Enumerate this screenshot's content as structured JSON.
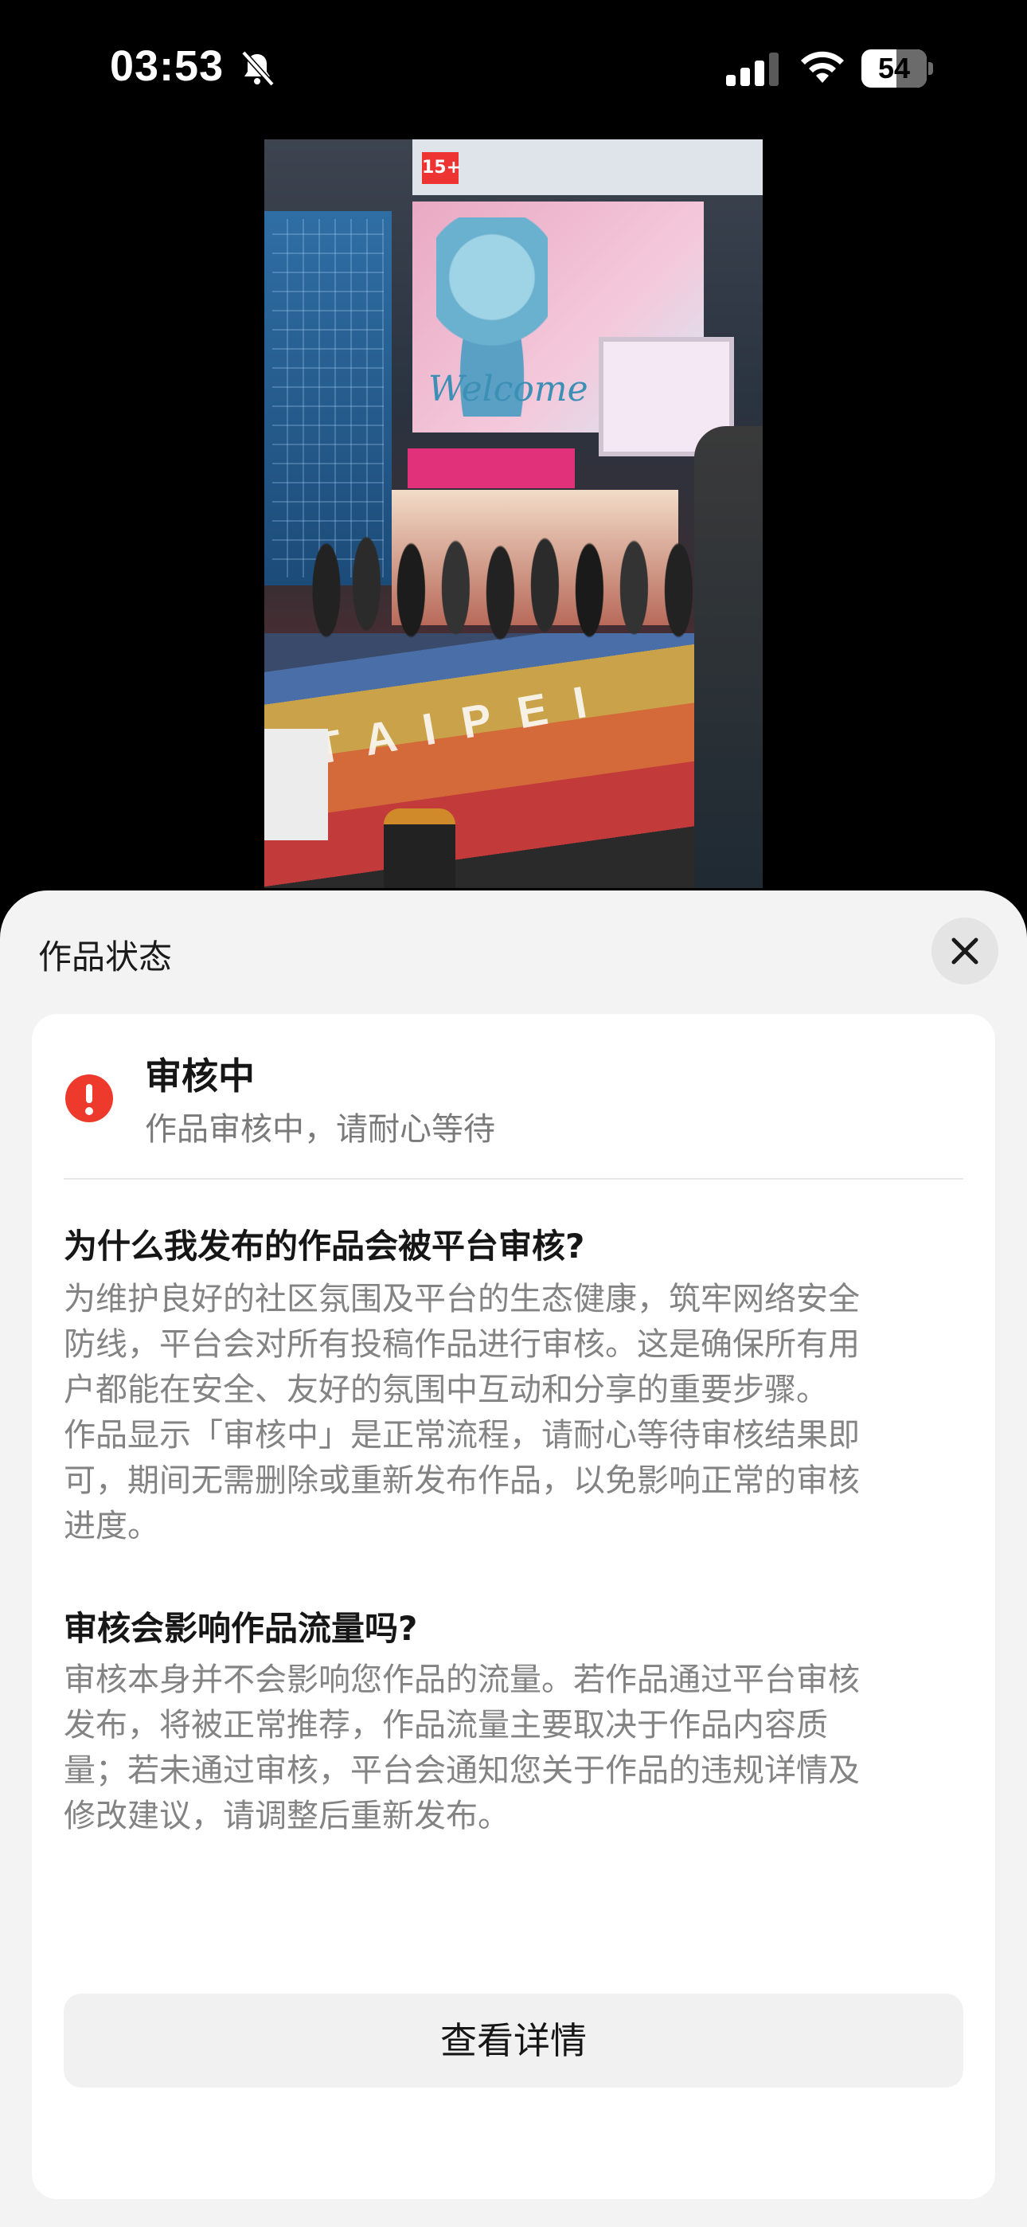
{
  "status_bar": {
    "time": "03:53",
    "battery": "54",
    "icons": [
      "bell-slash-icon",
      "cellular-signal-icon",
      "wifi-icon",
      "battery-icon"
    ]
  },
  "photo": {
    "content": "street scene photo preview (Ximending, Taipei)"
  },
  "sheet": {
    "title": "作品状态",
    "close_icon": "close-icon",
    "status": {
      "icon": "alert-circle-icon",
      "title": "审核中",
      "subtitle": "作品审核中，请耐心等待",
      "color": "#ee3a2d"
    },
    "faq": [
      {
        "question": "为什么我发布的作品会被平台审核?",
        "answer_lines": [
          "为维护良好的社区氛围及平台的生态健康，筑牢网络安全",
          "防线，平台会对所有投稿作品进行审核。这是确保所有用",
          "户都能在安全、友好的氛围中互动和分享的重要步骤。",
          "作品显示「审核中」是正常流程，请耐心等待审核结果即",
          "可，期间无需删除或重新发布作品，以免影响正常的审核",
          "进度。"
        ]
      },
      {
        "question": "审核会影响作品流量吗?",
        "answer_lines": [
          "审核本身并不会影响您作品的流量。若作品通过平台审核",
          "发布，将被正常推荐，作品流量主要取决于作品内容质",
          "量；若未通过审核，平台会通知您关于作品的违规详情及",
          "修改建议，请调整后重新发布。"
        ]
      }
    ],
    "button_label": "查看详情"
  }
}
